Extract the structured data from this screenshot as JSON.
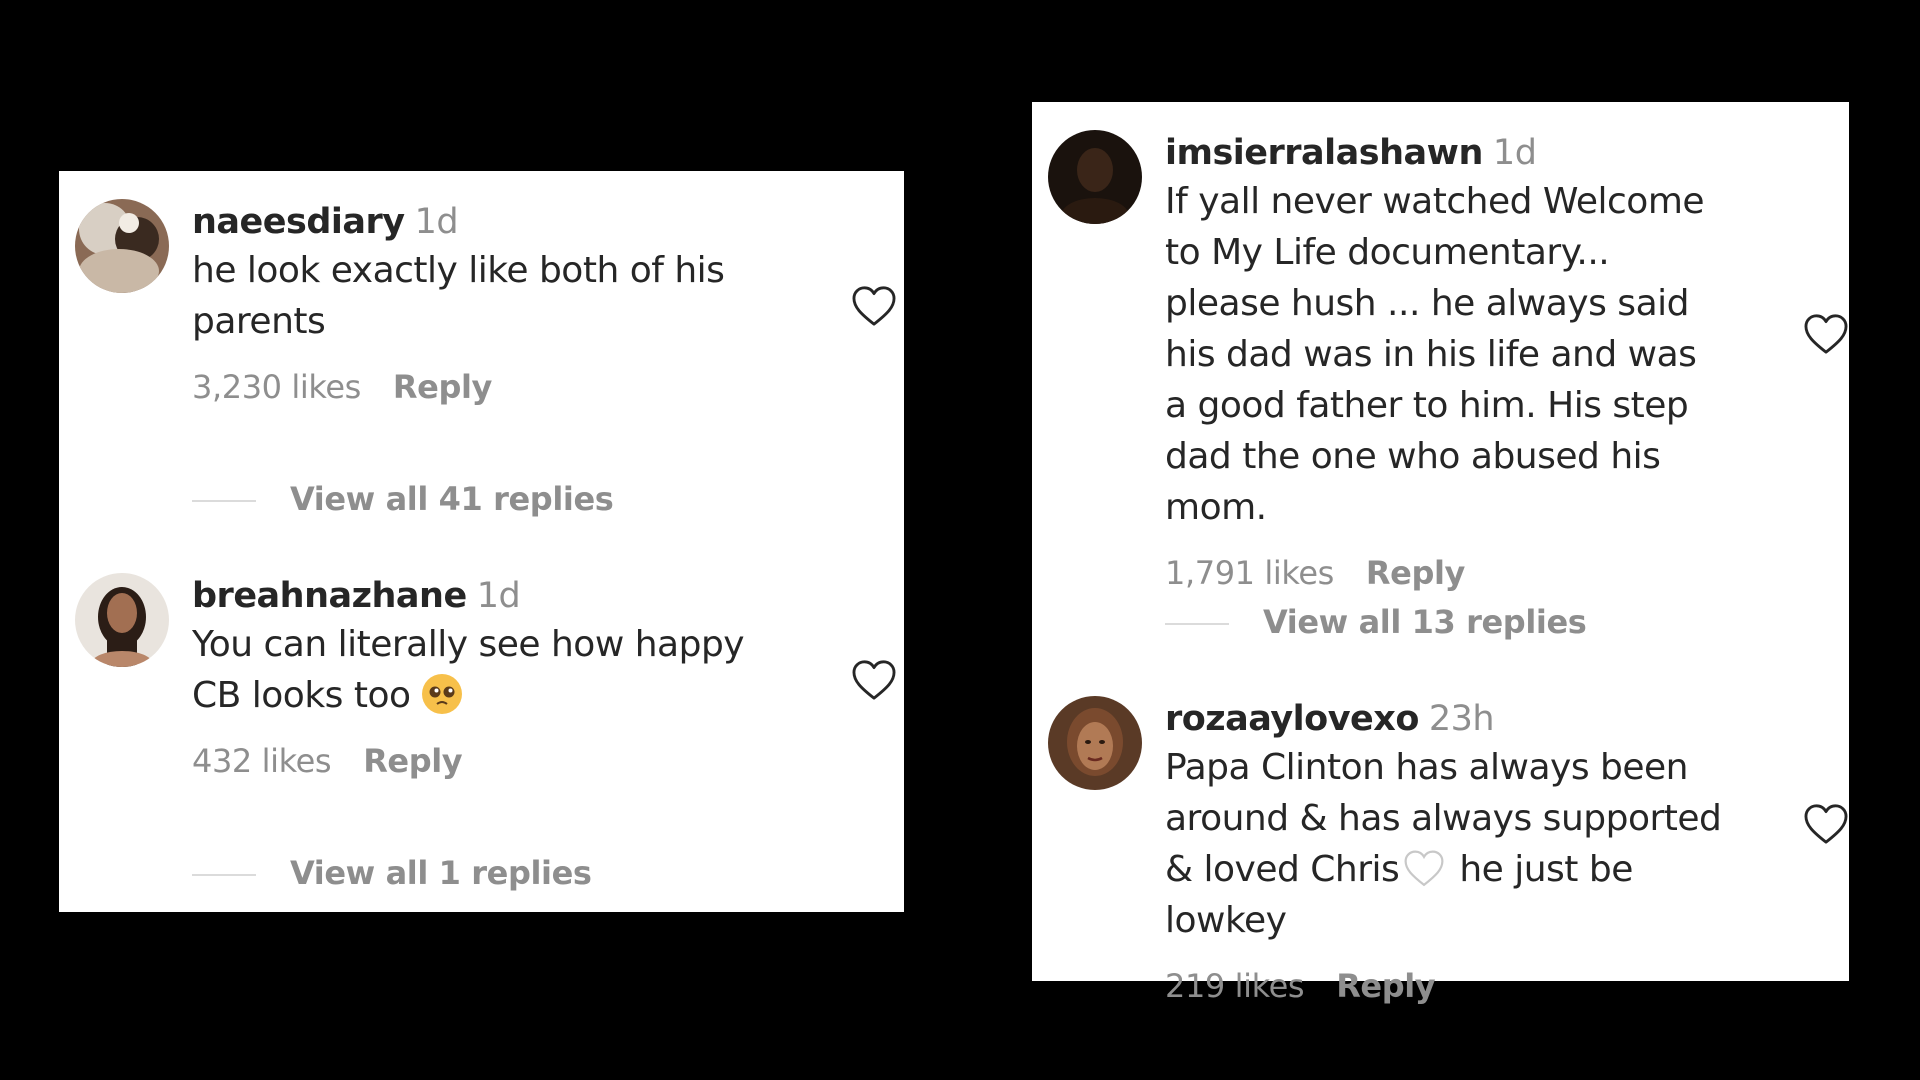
{
  "left_panel": {
    "comments": [
      {
        "username": "naeesdiary",
        "time": "1d",
        "text": "he look exactly like both of his parents",
        "likes": "3,230 likes",
        "reply_label": "Reply",
        "view_replies": "View all 41 replies",
        "avatar_icon": "avatar-photo",
        "like_icon": "heart-outline-icon"
      },
      {
        "username": "breahnazhane",
        "time": "1d",
        "text": "You can literally see how happy CB looks too",
        "emoji_icon": "pleading-face-emoji",
        "likes": "432 likes",
        "reply_label": "Reply",
        "view_replies": "View all 1 replies",
        "avatar_icon": "avatar-photo",
        "like_icon": "heart-outline-icon"
      }
    ]
  },
  "right_panel": {
    "comments": [
      {
        "username": "imsierralashawn",
        "time": "1d",
        "text": "If yall never watched Welcome to My Life documentary... please hush ... he always said his dad was in his life and was a good father to him. His step dad the one who abused his mom.",
        "likes": "1,791 likes",
        "reply_label": "Reply",
        "view_replies": "View all 13 replies",
        "avatar_icon": "avatar-photo",
        "like_icon": "heart-outline-icon"
      },
      {
        "username": "rozaaylovexo",
        "time": "23h",
        "text_before_icon": "Papa Clinton has always been around & has always supported & loved Chris",
        "inline_icon": "white-heart-emoji",
        "text_after_icon": "he just be lowkey",
        "likes": "219 likes",
        "reply_label": "Reply",
        "avatar_icon": "avatar-photo",
        "like_icon": "heart-outline-icon"
      }
    ]
  },
  "colors": {
    "background": "#000000",
    "panel": "#ffffff",
    "primary_text": "#262626",
    "secondary_text": "#8e8e8e",
    "divider": "#dbdbdb"
  }
}
